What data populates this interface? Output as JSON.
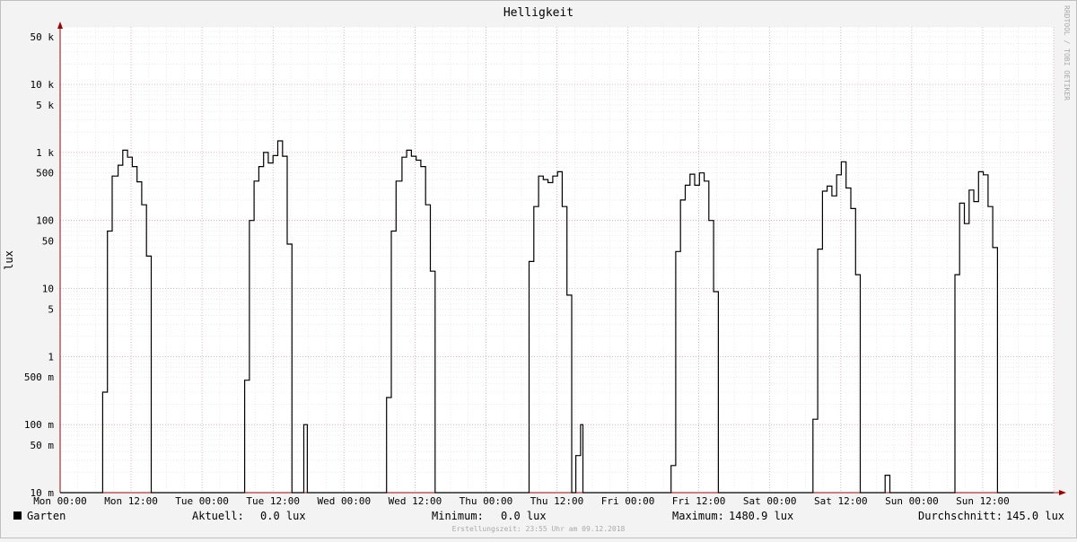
{
  "colors": {
    "background": "#f3f3f3",
    "canvas": "#ffffff",
    "grid_minor": "#dedede",
    "grid_major": "#e8a0a0",
    "line": "#000000",
    "axis": "#a00000",
    "frame": "#c0c0c0"
  },
  "legend": {
    "swatch_color": "#000000",
    "series_label": "Garten",
    "current_label": "Aktuell:",
    "current_value": "0.0 lux",
    "min_label": "Minimum:",
    "min_value": "0.0 lux",
    "max_label": "Maximum:",
    "max_value": "1480.9 lux",
    "avg_label": "Durchschnitt:",
    "avg_value": "145.0 lux"
  },
  "footer": "Erstellungszeit: 23:55 Uhr am 09.12.2018",
  "watermark": "RRDTOOL / TOBI OETIKER",
  "chart_data": {
    "type": "line",
    "title": "Helligkeit",
    "ylabel": "lux",
    "xlabel": "",
    "y_scale": "log",
    "ylim": [
      0.01,
      70000
    ],
    "xlim_hours": [
      0,
      168
    ],
    "grid": true,
    "x_ticks": [
      {
        "hour": 0,
        "label": "Mon 00:00"
      },
      {
        "hour": 12,
        "label": "Mon 12:00"
      },
      {
        "hour": 24,
        "label": "Tue 00:00"
      },
      {
        "hour": 36,
        "label": "Tue 12:00"
      },
      {
        "hour": 48,
        "label": "Wed 00:00"
      },
      {
        "hour": 60,
        "label": "Wed 12:00"
      },
      {
        "hour": 72,
        "label": "Thu 00:00"
      },
      {
        "hour": 84,
        "label": "Thu 12:00"
      },
      {
        "hour": 96,
        "label": "Fri 00:00"
      },
      {
        "hour": 108,
        "label": "Fri 12:00"
      },
      {
        "hour": 120,
        "label": "Sat 00:00"
      },
      {
        "hour": 132,
        "label": "Sat 12:00"
      },
      {
        "hour": 144,
        "label": "Sun 00:00"
      },
      {
        "hour": 156,
        "label": "Sun 12:00"
      }
    ],
    "y_ticks": [
      {
        "value": 50000,
        "label": "50 k"
      },
      {
        "value": 10000,
        "label": "10 k"
      },
      {
        "value": 5000,
        "label": "5 k"
      },
      {
        "value": 1000,
        "label": "1 k"
      },
      {
        "value": 500,
        "label": "500"
      },
      {
        "value": 100,
        "label": "100"
      },
      {
        "value": 50,
        "label": "50"
      },
      {
        "value": 10,
        "label": "10"
      },
      {
        "value": 5,
        "label": "5"
      },
      {
        "value": 1,
        "label": "1"
      },
      {
        "value": 0.5,
        "label": "500 m"
      },
      {
        "value": 0.1,
        "label": "100 m"
      },
      {
        "value": 0.05,
        "label": "50 m"
      },
      {
        "value": 0.01,
        "label": "10 m"
      }
    ],
    "series": [
      {
        "name": "Garten",
        "color": "#000000",
        "step": true,
        "points": [
          [
            0,
            0.01
          ],
          [
            7.2,
            0.01
          ],
          [
            7.2,
            0.3
          ],
          [
            8.0,
            0.3
          ],
          [
            8.0,
            70
          ],
          [
            8.8,
            70
          ],
          [
            8.8,
            450
          ],
          [
            9.8,
            450
          ],
          [
            9.8,
            650
          ],
          [
            10.6,
            650
          ],
          [
            10.6,
            1080
          ],
          [
            11.4,
            1080
          ],
          [
            11.4,
            850
          ],
          [
            12.2,
            850
          ],
          [
            12.2,
            620
          ],
          [
            13.0,
            620
          ],
          [
            13.0,
            370
          ],
          [
            13.8,
            370
          ],
          [
            13.8,
            170
          ],
          [
            14.6,
            170
          ],
          [
            14.6,
            30
          ],
          [
            15.4,
            30
          ],
          [
            15.4,
            0.01
          ],
          [
            31.2,
            0.01
          ],
          [
            31.2,
            0.45
          ],
          [
            32.0,
            0.45
          ],
          [
            32.0,
            100
          ],
          [
            32.8,
            100
          ],
          [
            32.8,
            380
          ],
          [
            33.6,
            380
          ],
          [
            33.6,
            620
          ],
          [
            34.4,
            620
          ],
          [
            34.4,
            1000
          ],
          [
            35.2,
            1000
          ],
          [
            35.2,
            700
          ],
          [
            36.0,
            700
          ],
          [
            36.0,
            900
          ],
          [
            36.8,
            900
          ],
          [
            36.8,
            1480.9
          ],
          [
            37.6,
            1480.9
          ],
          [
            37.6,
            880
          ],
          [
            38.4,
            880
          ],
          [
            38.4,
            45
          ],
          [
            39.2,
            45
          ],
          [
            39.2,
            0.01
          ],
          [
            41.2,
            0.01
          ],
          [
            41.2,
            0.1
          ],
          [
            41.8,
            0.1
          ],
          [
            41.8,
            0.01
          ],
          [
            55.2,
            0.01
          ],
          [
            55.2,
            0.25
          ],
          [
            56.0,
            0.25
          ],
          [
            56.0,
            70
          ],
          [
            56.8,
            70
          ],
          [
            56.8,
            380
          ],
          [
            57.8,
            380
          ],
          [
            57.8,
            850
          ],
          [
            58.6,
            850
          ],
          [
            58.6,
            1080
          ],
          [
            59.4,
            1080
          ],
          [
            59.4,
            880
          ],
          [
            60.2,
            880
          ],
          [
            60.2,
            770
          ],
          [
            61.0,
            770
          ],
          [
            61.0,
            620
          ],
          [
            61.8,
            620
          ],
          [
            61.8,
            170
          ],
          [
            62.6,
            170
          ],
          [
            62.6,
            18
          ],
          [
            63.4,
            18
          ],
          [
            63.4,
            0.01
          ],
          [
            79.3,
            0.01
          ],
          [
            79.3,
            25
          ],
          [
            80.1,
            25
          ],
          [
            80.1,
            160
          ],
          [
            80.9,
            160
          ],
          [
            80.9,
            450
          ],
          [
            81.7,
            450
          ],
          [
            81.7,
            400
          ],
          [
            82.5,
            400
          ],
          [
            82.5,
            360
          ],
          [
            83.3,
            360
          ],
          [
            83.3,
            450
          ],
          [
            84.1,
            450
          ],
          [
            84.1,
            520
          ],
          [
            84.9,
            520
          ],
          [
            84.9,
            160
          ],
          [
            85.7,
            160
          ],
          [
            85.7,
            8
          ],
          [
            86.5,
            8
          ],
          [
            86.5,
            0.01
          ],
          [
            87.2,
            0.01
          ],
          [
            87.2,
            0.035
          ],
          [
            88.0,
            0.035
          ],
          [
            88.0,
            0.1
          ],
          [
            88.4,
            0.1
          ],
          [
            88.4,
            0.01
          ],
          [
            103.3,
            0.01
          ],
          [
            103.3,
            0.025
          ],
          [
            104.1,
            0.025
          ],
          [
            104.1,
            35
          ],
          [
            104.9,
            35
          ],
          [
            104.9,
            200
          ],
          [
            105.7,
            200
          ],
          [
            105.7,
            330
          ],
          [
            106.5,
            330
          ],
          [
            106.5,
            480
          ],
          [
            107.3,
            480
          ],
          [
            107.3,
            330
          ],
          [
            108.1,
            330
          ],
          [
            108.1,
            500
          ],
          [
            108.9,
            500
          ],
          [
            108.9,
            380
          ],
          [
            109.7,
            380
          ],
          [
            109.7,
            100
          ],
          [
            110.5,
            100
          ],
          [
            110.5,
            9
          ],
          [
            111.3,
            9
          ],
          [
            111.3,
            0.01
          ],
          [
            127.3,
            0.01
          ],
          [
            127.3,
            0.12
          ],
          [
            128.1,
            0.12
          ],
          [
            128.1,
            38
          ],
          [
            128.9,
            38
          ],
          [
            128.9,
            270
          ],
          [
            129.7,
            270
          ],
          [
            129.7,
            320
          ],
          [
            130.5,
            320
          ],
          [
            130.5,
            230
          ],
          [
            131.3,
            230
          ],
          [
            131.3,
            470
          ],
          [
            132.1,
            470
          ],
          [
            132.1,
            730
          ],
          [
            132.9,
            730
          ],
          [
            132.9,
            300
          ],
          [
            133.7,
            300
          ],
          [
            133.7,
            150
          ],
          [
            134.5,
            150
          ],
          [
            134.5,
            16
          ],
          [
            135.3,
            16
          ],
          [
            135.3,
            0.01
          ],
          [
            139.5,
            0.01
          ],
          [
            139.5,
            0.018
          ],
          [
            140.3,
            0.018
          ],
          [
            140.3,
            0.01
          ],
          [
            151.3,
            0.01
          ],
          [
            151.3,
            16
          ],
          [
            152.1,
            16
          ],
          [
            152.1,
            180
          ],
          [
            152.9,
            180
          ],
          [
            152.9,
            90
          ],
          [
            153.7,
            90
          ],
          [
            153.7,
            280
          ],
          [
            154.5,
            280
          ],
          [
            154.5,
            190
          ],
          [
            155.3,
            190
          ],
          [
            155.3,
            520
          ],
          [
            156.1,
            520
          ],
          [
            156.1,
            470
          ],
          [
            156.9,
            470
          ],
          [
            156.9,
            160
          ],
          [
            157.7,
            160
          ],
          [
            157.7,
            40
          ],
          [
            158.5,
            40
          ],
          [
            158.5,
            0.01
          ],
          [
            168,
            0.01
          ]
        ]
      }
    ]
  }
}
